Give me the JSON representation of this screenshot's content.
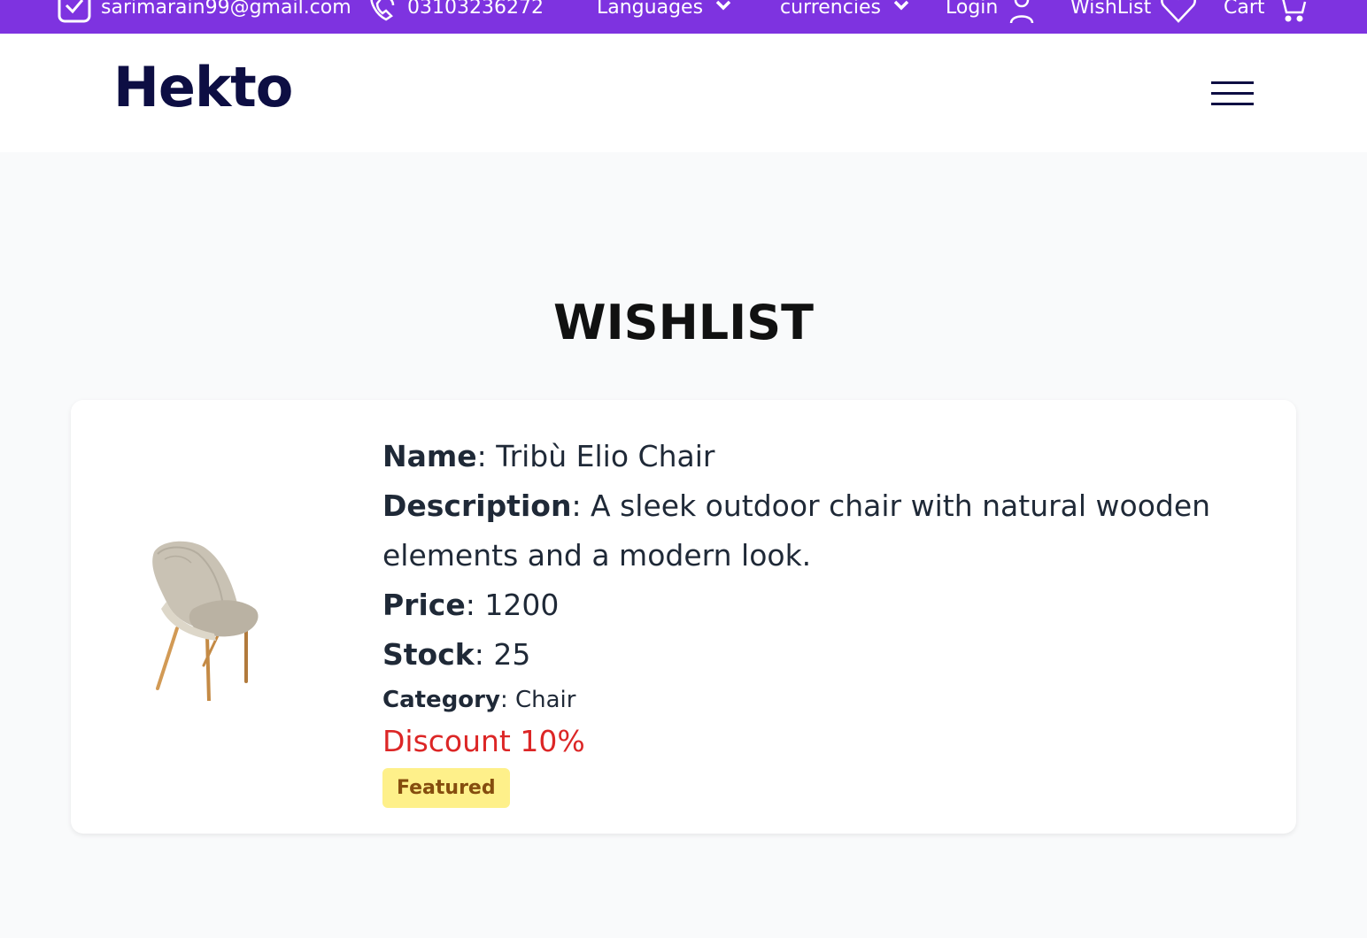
{
  "topbar": {
    "email": "sarimarain99@gmail.com",
    "phone": "03103236272",
    "languages": "Languages",
    "currencies": "currencies",
    "login": "Login",
    "wishlist": "WishList",
    "cart": "Cart",
    "bg_color": "#7e33e0"
  },
  "header": {
    "logo": "Hekto",
    "logo_color": "#0d0e43"
  },
  "page": {
    "title": "WISHLIST"
  },
  "item": {
    "name_label": "Name",
    "name": "Tribù Elio Chair",
    "description_label": "Description",
    "description": "A sleek outdoor chair with natural wooden elements and a modern look.",
    "price_label": "Price",
    "price": "1200",
    "stock_label": "Stock",
    "stock": "25",
    "category_label": "Category",
    "category": "Chair",
    "discount": "Discount 10%",
    "badge": "Featured",
    "discount_color": "#dc2626",
    "badge_bg": "#fef08a"
  }
}
